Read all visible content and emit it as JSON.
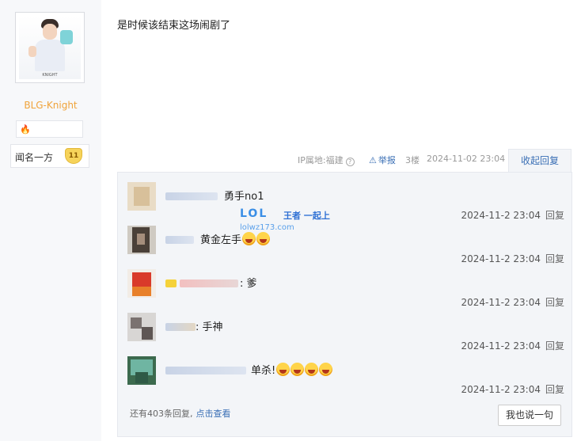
{
  "user": {
    "name": "BLG-Knight",
    "avatar_caption": "KNIGHT",
    "badge_label": "闻名一方",
    "level": "11"
  },
  "post": {
    "text": "是时候该结束这场闹剧了",
    "ip": "IP属地:福建",
    "report": "举报",
    "floor": "3楼",
    "time": "2024-11-02 23:04",
    "collapse_label": "收起回复"
  },
  "replies": [
    {
      "text": "勇手no1",
      "time": "2024-11-2 23:04",
      "reply_label": "回复",
      "emoji_count": 0
    },
    {
      "text": "黄金左手",
      "time": "2024-11-2 23:04",
      "reply_label": "回复",
      "emoji_count": 2
    },
    {
      "text": ": 爹",
      "time": "2024-11-2 23:04",
      "reply_label": "回复",
      "emoji_count": 0
    },
    {
      "text": ": 手神",
      "time": "2024-11-2 23:04",
      "reply_label": "回复",
      "emoji_count": 0
    },
    {
      "text": "单杀!",
      "time": "2024-11-2 23:04",
      "reply_label": "回复",
      "emoji_count": 4
    }
  ],
  "footer": {
    "more_count_text": "还有403条回复,",
    "view_link": "点击查看",
    "say_button": "我也说一句"
  },
  "watermark": {
    "logo": "LOL",
    "brand": "王者 一起上",
    "url": "lolwz173.com"
  },
  "icons": {
    "report": "warning-triangle-icon",
    "help": "question-circle-icon",
    "badge": "flame-icon",
    "emoji": "laughing-face-icon"
  },
  "colors": {
    "accent_blue": "#3a6fb5",
    "username_orange": "#f0a33a",
    "panel_bg": "#f7f8fa",
    "reply_bg": "#f3f5f8"
  }
}
